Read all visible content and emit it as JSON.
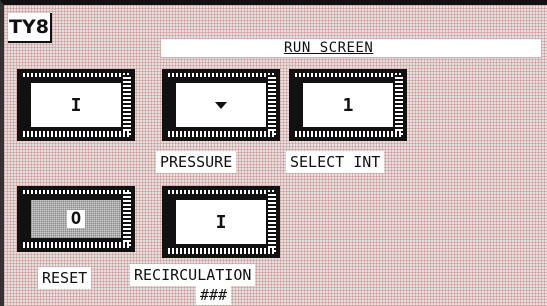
{
  "logo": "TY8",
  "title": "RUN SCREEN",
  "buttons": {
    "run": {
      "value": "I"
    },
    "pressure": {
      "label": "PRESSURE",
      "icon": "down-arrow-icon"
    },
    "select_int": {
      "value": "1",
      "label": "SELECT INT"
    },
    "reset": {
      "value": "O",
      "label": "RESET"
    },
    "recirculation": {
      "value": "I",
      "label": "RECIRCULATION",
      "sublabel": "###"
    }
  },
  "colors": {
    "background": "#e8dedd",
    "grid": "#b97878",
    "ink": "#111111"
  }
}
